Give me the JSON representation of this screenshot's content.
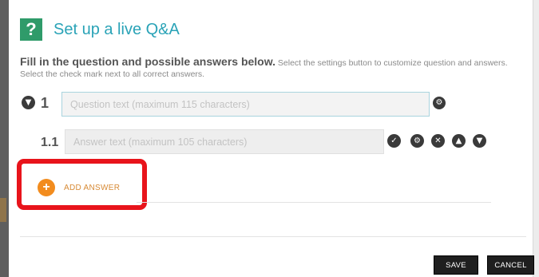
{
  "dialog": {
    "badge": "?",
    "title": "Set up a live Q&A",
    "instructions_bold": "Fill in the question and possible answers below.",
    "instructions_rest": " Select the settings button to customize question and answers. Select the check mark next to all correct answers."
  },
  "question": {
    "number": "1",
    "placeholder": "Question text (maximum 115 characters)",
    "value": ""
  },
  "answer": {
    "number": "1.1",
    "placeholder": "Answer text (maximum 105 characters)",
    "value": ""
  },
  "icons": {
    "collapse": "chevron-down-icon",
    "question_settings": "gear-icon",
    "correct": "checkmark-icon",
    "answer_settings": "gear-icon",
    "delete": "close-icon",
    "move_up": "arrow-up-icon",
    "move_down": "arrow-down-icon",
    "add": "plus-icon"
  },
  "add_answer": {
    "plus": "+",
    "label": "ADD ANSWER"
  },
  "footer": {
    "save_label": "SAVE",
    "cancel_label": "CANCEL"
  },
  "colors": {
    "title": "#2aa3b7",
    "badge": "#2f9b6a",
    "add_accent": "#f28c1e",
    "highlight": "#e8141b",
    "button_bg": "#1f1f1f"
  }
}
